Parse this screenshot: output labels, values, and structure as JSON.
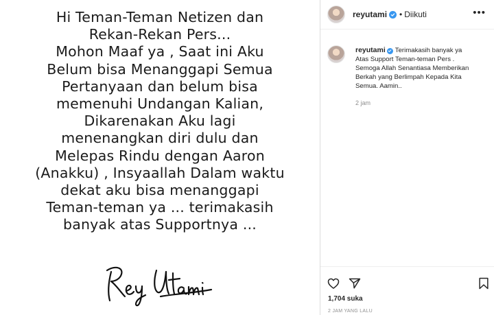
{
  "post": {
    "lines": [
      "Hi Teman-Teman Netizen dan",
      "Rekan-Rekan Pers...",
      "Mohon Maaf ya , Saat ini Aku",
      "Belum bisa Menanggapi Semua",
      "Pertanyaan dan belum bisa",
      "memenuhi Undangan Kalian,",
      "Dikarenakan Aku lagi",
      "menenangkan diri dulu dan",
      "Melepas Rindu dengan Aaron",
      "(Anakku) , Insyaallah Dalam waktu",
      "dekat aku bisa menanggapi",
      "Teman-teman ya ... terimakasih",
      "banyak atas Supportnya ..."
    ],
    "signature": "Rey Utami"
  },
  "header": {
    "username": "reyutami",
    "separator": "•",
    "follow_status": "Diikuti",
    "more_icon": "more-horizontal-icon"
  },
  "caption": {
    "username": "reyutami",
    "line1": "Terimakasih banyak ya",
    "line2": "Atas Support Teman-teman Pers .",
    "line3": "Semoga Allah Senantiasa Memberikan",
    "line4": "Berkah yang Berlimpah Kepada Kita",
    "line5": "Semua. Aamin..",
    "time": "2 jam"
  },
  "actions": {
    "like_icon": "heart-icon",
    "share_icon": "send-icon",
    "save_icon": "bookmark-icon"
  },
  "likes": "1,704 suka",
  "date": "2 JAM YANG LALU",
  "colors": {
    "verified_badge": "#3897f0",
    "muted_text": "#8e8e8e",
    "border": "#dbdbdb"
  }
}
